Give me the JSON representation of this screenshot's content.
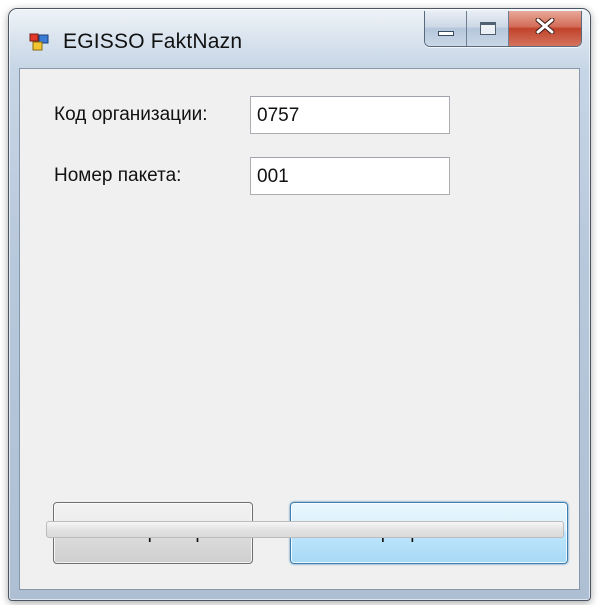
{
  "window": {
    "title": "EGISSO FaktNazn"
  },
  "icons": {
    "app": "app-window-icon",
    "minimize": "minimize-icon",
    "maximize": "maximize-icon",
    "close": "close-icon"
  },
  "form": {
    "org_code_label": "Код организации:",
    "org_code_value": "0757",
    "packet_number_label": "Номер пакета:",
    "packet_number_value": "001"
  },
  "buttons": {
    "import_label": "Импорт мер",
    "export_label": "Экспортировать в XML"
  },
  "progress": {
    "value": 0
  },
  "colors": {
    "close_button": "#c1432b",
    "focused_button_border": "#3c7fb1",
    "client_background": "#f0f0f0"
  }
}
